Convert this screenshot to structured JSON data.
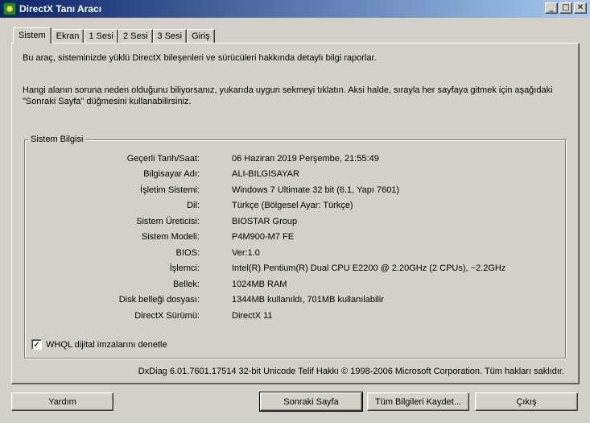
{
  "window": {
    "title": "DirectX Tanı Aracı",
    "controls": {
      "minimize": "_",
      "maximize": "□",
      "close": "✕"
    }
  },
  "tabs": [
    "Sistem",
    "Ekran",
    "1 Sesi",
    "2 Sesi",
    "3 Sesi",
    "Giriş"
  ],
  "active_tab": "Sistem",
  "intro": {
    "line1": "Bu araç, sisteminizde yüklü DirectX bileşenleri ve sürücüleri hakkında detaylı bilgi raporlar.",
    "line2": "Hangi alanın soruna neden olduğunu biliyorsanız, yukarıda uygun sekmeyi tıklatın.  Aksi halde, sırayla her sayfaya gitmek için aşağıdaki \"Sonraki Sayfa\" düğmesini kullanabilirsiniz."
  },
  "system_info": {
    "legend": "Sistem Bilgisi",
    "rows": [
      {
        "label": "Geçerli Tarih/Saat:",
        "value": "06 Haziran 2019 Perşembe, 21:55:49"
      },
      {
        "label": "Bilgisayar Adı:",
        "value": "ALI-BILGISAYAR"
      },
      {
        "label": "İşletim Sistemi:",
        "value": "Windows 7 Ultimate 32 bit (6.1, Yapı 7601)"
      },
      {
        "label": "Dil:",
        "value": "Türkçe (Bölgesel Ayar: Türkçe)"
      },
      {
        "label": "Sistem Üreticisi:",
        "value": "BIOSTAR Group"
      },
      {
        "label": "Sistem Modeli:",
        "value": "P4M900-M7 FE"
      },
      {
        "label": "BIOS:",
        "value": "Ver:1.0"
      },
      {
        "label": "İşlemci:",
        "value": "Intel(R) Pentium(R) Dual  CPU  E2200  @ 2.20GHz (2 CPUs), ~2.2GHz"
      },
      {
        "label": "Bellek:",
        "value": "1024MB RAM"
      },
      {
        "label": "Disk belleği dosyası:",
        "value": "1344MB kullanıldı, 701MB kullanılabilir"
      },
      {
        "label": "DirectX Sürümü:",
        "value": "DirectX 11"
      }
    ]
  },
  "whql": {
    "label": "WHQL dijital imzalarını denetle",
    "checked": true,
    "mark": "✓"
  },
  "footer": "DxDiag 6.01.7601.17514 32-bit Unicode  Telif Hakkı © 1998-2006 Microsoft Corporation.  Tüm hakları saklıdır.",
  "buttons": {
    "help": "Yardım",
    "next": "Sonraki Sayfa",
    "save_all": "Tüm Bilgileri Kaydet...",
    "exit": "Çıkış"
  }
}
